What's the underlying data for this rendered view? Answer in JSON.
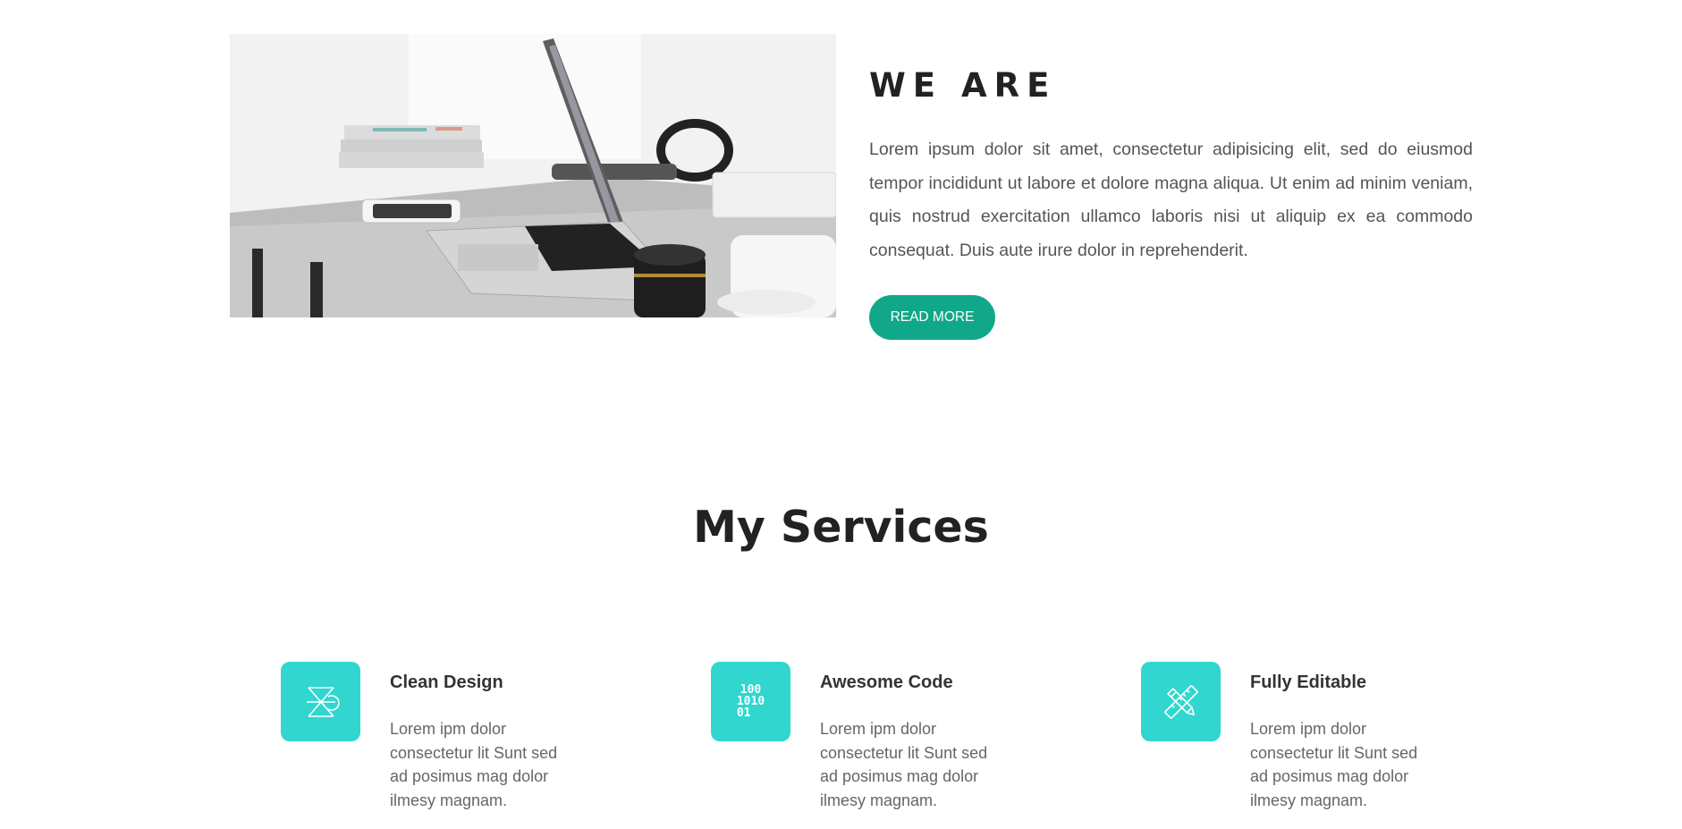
{
  "about": {
    "image_alt": "Laptop on desk",
    "title": "WE ARE",
    "body": "Lorem ipsum dolor sit amet, consectetur adipisicing elit, sed do eiusmod tempor incididunt ut labore et dolore magna aliqua. Ut enim ad minim veniam, quis nostrud exercitation ullamco laboris nisi ut aliquip ex ea commodo consequat. Duis aute irure dolor in reprehenderit.",
    "button_label": "READ MORE"
  },
  "services": {
    "title": "My Services",
    "items": [
      {
        "icon": "hourglass-icon",
        "name": "Clean Design",
        "description": "Lorem ipm dolor consectetur lit Sunt sed ad posimus mag dolor ilmesy magnam."
      },
      {
        "icon": "binary-code-icon",
        "name": "Awesome Code",
        "description": "Lorem ipm dolor consectetur lit Sunt sed ad posimus mag dolor ilmesy magnam.",
        "icon_text": [
          "100",
          "1010",
          "01"
        ]
      },
      {
        "icon": "pencil-ruler-icon",
        "name": "Fully Editable",
        "description": "Lorem ipm dolor consectetur lit Sunt sed ad posimus mag dolor ilmesy magnam."
      }
    ]
  },
  "colors": {
    "accent_button": "#11a88a",
    "icon_tile": "#31d6cf",
    "heading": "#222222",
    "body_text": "#555555"
  }
}
